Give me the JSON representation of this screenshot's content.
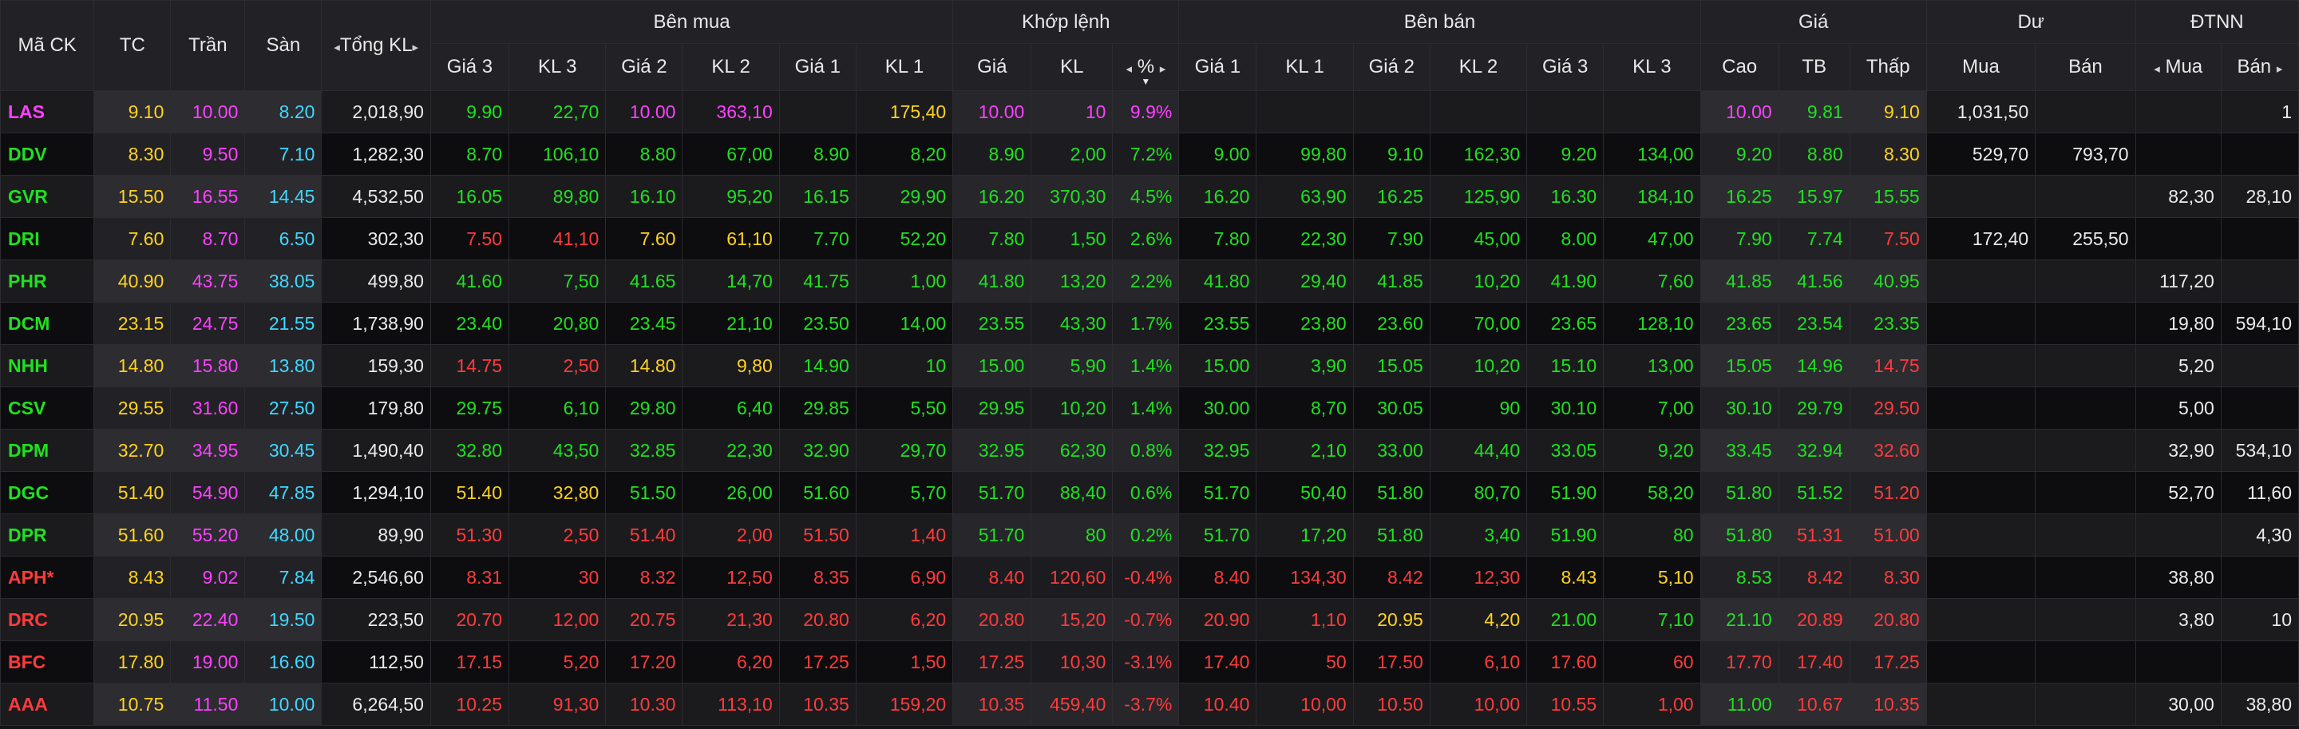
{
  "headers": {
    "symbol": "Mã CK",
    "ref": "TC",
    "ceil": "Trần",
    "floor": "Sàn",
    "total_vol": "Tổng KL",
    "buy_side": "Bên mua",
    "matched": "Khớp lệnh",
    "sell_side": "Bên bán",
    "price": "Giá",
    "residual": "Dư",
    "foreign": "ĐTNN",
    "buy_sub": [
      "Giá 3",
      "KL 3",
      "Giá 2",
      "KL 2",
      "Giá 1",
      "KL 1"
    ],
    "match_sub": [
      "Giá",
      "KL",
      "%"
    ],
    "sell_sub": [
      "Giá 1",
      "KL 1",
      "Giá 2",
      "KL 2",
      "Giá 3",
      "KL 3"
    ],
    "price_sub": [
      "Cao",
      "TB",
      "Thấp"
    ],
    "residual_sub": [
      "Mua",
      "Bán"
    ],
    "foreign_sub": [
      "Mua",
      "Bán"
    ]
  },
  "icons": {
    "arrow_left": "◂",
    "arrow_right": "▸",
    "sort_desc": "▼"
  },
  "colors": {
    "up": "#1fe11f",
    "down": "#ff3b3b",
    "reference": "#ffd21f",
    "ceiling": "#ff40ff",
    "floor": "#40d8ff"
  },
  "rows": [
    {
      "sym": [
        "LAS",
        "ceil"
      ],
      "tc": "9.10",
      "tran": "10.00",
      "san": "8.20",
      "total": "2,018,90",
      "b3": [
        "9.90",
        "up"
      ],
      "bk3": [
        "22,70",
        "up"
      ],
      "b2": [
        "10.00",
        "ceil"
      ],
      "bk2": [
        "363,10",
        "ceil"
      ],
      "b1": [
        "",
        ""
      ],
      "bk1": [
        "175,40",
        "ref"
      ],
      "mp": [
        "10.00",
        "ceil"
      ],
      "mk": [
        "10",
        "ceil"
      ],
      "pct": [
        "9.9%",
        "ceil"
      ],
      "s1": [
        "",
        ""
      ],
      "sk1": [
        "",
        ""
      ],
      "s2": [
        "",
        ""
      ],
      "sk2": [
        "",
        ""
      ],
      "s3": [
        "",
        ""
      ],
      "sk3": [
        "",
        ""
      ],
      "cao": [
        "10.00",
        "ceil"
      ],
      "tb": [
        "9.81",
        "up"
      ],
      "thap": [
        "9.10",
        "ref"
      ],
      "dm": "1,031,50",
      "db": "",
      "fm": "",
      "fb": "1"
    },
    {
      "sym": [
        "DDV",
        "up"
      ],
      "tc": "8.30",
      "tran": "9.50",
      "san": "7.10",
      "total": "1,282,30",
      "b3": [
        "8.70",
        "up"
      ],
      "bk3": [
        "106,10",
        "up"
      ],
      "b2": [
        "8.80",
        "up"
      ],
      "bk2": [
        "67,00",
        "up"
      ],
      "b1": [
        "8.90",
        "up"
      ],
      "bk1": [
        "8,20",
        "up"
      ],
      "mp": [
        "8.90",
        "up"
      ],
      "mk": [
        "2,00",
        "up"
      ],
      "pct": [
        "7.2%",
        "up"
      ],
      "s1": [
        "9.00",
        "up"
      ],
      "sk1": [
        "99,80",
        "up"
      ],
      "s2": [
        "9.10",
        "up"
      ],
      "sk2": [
        "162,30",
        "up"
      ],
      "s3": [
        "9.20",
        "up"
      ],
      "sk3": [
        "134,00",
        "up"
      ],
      "cao": [
        "9.20",
        "up"
      ],
      "tb": [
        "8.80",
        "up"
      ],
      "thap": [
        "8.30",
        "ref"
      ],
      "dm": "529,70",
      "db": "793,70",
      "fm": "",
      "fb": ""
    },
    {
      "sym": [
        "GVR",
        "up"
      ],
      "tc": "15.50",
      "tran": "16.55",
      "san": "14.45",
      "total": "4,532,50",
      "b3": [
        "16.05",
        "up"
      ],
      "bk3": [
        "89,80",
        "up"
      ],
      "b2": [
        "16.10",
        "up"
      ],
      "bk2": [
        "95,20",
        "up"
      ],
      "b1": [
        "16.15",
        "up"
      ],
      "bk1": [
        "29,90",
        "up"
      ],
      "mp": [
        "16.20",
        "up"
      ],
      "mk": [
        "370,30",
        "up"
      ],
      "pct": [
        "4.5%",
        "up"
      ],
      "s1": [
        "16.20",
        "up"
      ],
      "sk1": [
        "63,90",
        "up"
      ],
      "s2": [
        "16.25",
        "up"
      ],
      "sk2": [
        "125,90",
        "up"
      ],
      "s3": [
        "16.30",
        "up"
      ],
      "sk3": [
        "184,10",
        "up"
      ],
      "cao": [
        "16.25",
        "up"
      ],
      "tb": [
        "15.97",
        "up"
      ],
      "thap": [
        "15.55",
        "up"
      ],
      "dm": "",
      "db": "",
      "fm": "82,30",
      "fb": "28,10"
    },
    {
      "sym": [
        "DRI",
        "up"
      ],
      "tc": "7.60",
      "tran": "8.70",
      "san": "6.50",
      "total": "302,30",
      "b3": [
        "7.50",
        "dn"
      ],
      "bk3": [
        "41,10",
        "dn"
      ],
      "b2": [
        "7.60",
        "ref"
      ],
      "bk2": [
        "61,10",
        "ref"
      ],
      "b1": [
        "7.70",
        "up"
      ],
      "bk1": [
        "52,20",
        "up"
      ],
      "mp": [
        "7.80",
        "up"
      ],
      "mk": [
        "1,50",
        "up"
      ],
      "pct": [
        "2.6%",
        "up"
      ],
      "s1": [
        "7.80",
        "up"
      ],
      "sk1": [
        "22,30",
        "up"
      ],
      "s2": [
        "7.90",
        "up"
      ],
      "sk2": [
        "45,00",
        "up"
      ],
      "s3": [
        "8.00",
        "up"
      ],
      "sk3": [
        "47,00",
        "up"
      ],
      "cao": [
        "7.90",
        "up"
      ],
      "tb": [
        "7.74",
        "up"
      ],
      "thap": [
        "7.50",
        "dn"
      ],
      "dm": "172,40",
      "db": "255,50",
      "fm": "",
      "fb": ""
    },
    {
      "sym": [
        "PHR",
        "up"
      ],
      "tc": "40.90",
      "tran": "43.75",
      "san": "38.05",
      "total": "499,80",
      "b3": [
        "41.60",
        "up"
      ],
      "bk3": [
        "7,50",
        "up"
      ],
      "b2": [
        "41.65",
        "up"
      ],
      "bk2": [
        "14,70",
        "up"
      ],
      "b1": [
        "41.75",
        "up"
      ],
      "bk1": [
        "1,00",
        "up"
      ],
      "mp": [
        "41.80",
        "up"
      ],
      "mk": [
        "13,20",
        "up"
      ],
      "pct": [
        "2.2%",
        "up"
      ],
      "s1": [
        "41.80",
        "up"
      ],
      "sk1": [
        "29,40",
        "up"
      ],
      "s2": [
        "41.85",
        "up"
      ],
      "sk2": [
        "10,20",
        "up"
      ],
      "s3": [
        "41.90",
        "up"
      ],
      "sk3": [
        "7,60",
        "up"
      ],
      "cao": [
        "41.85",
        "up"
      ],
      "tb": [
        "41.56",
        "up"
      ],
      "thap": [
        "40.95",
        "up"
      ],
      "dm": "",
      "db": "",
      "fm": "117,20",
      "fb": ""
    },
    {
      "sym": [
        "DCM",
        "up"
      ],
      "tc": "23.15",
      "tran": "24.75",
      "san": "21.55",
      "total": "1,738,90",
      "b3": [
        "23.40",
        "up"
      ],
      "bk3": [
        "20,80",
        "up"
      ],
      "b2": [
        "23.45",
        "up"
      ],
      "bk2": [
        "21,10",
        "up"
      ],
      "b1": [
        "23.50",
        "up"
      ],
      "bk1": [
        "14,00",
        "up"
      ],
      "mp": [
        "23.55",
        "up"
      ],
      "mk": [
        "43,30",
        "up"
      ],
      "pct": [
        "1.7%",
        "up"
      ],
      "s1": [
        "23.55",
        "up"
      ],
      "sk1": [
        "23,80",
        "up"
      ],
      "s2": [
        "23.60",
        "up"
      ],
      "sk2": [
        "70,00",
        "up"
      ],
      "s3": [
        "23.65",
        "up"
      ],
      "sk3": [
        "128,10",
        "up"
      ],
      "cao": [
        "23.65",
        "up"
      ],
      "tb": [
        "23.54",
        "up"
      ],
      "thap": [
        "23.35",
        "up"
      ],
      "dm": "",
      "db": "",
      "fm": "19,80",
      "fb": "594,10"
    },
    {
      "sym": [
        "NHH",
        "up"
      ],
      "tc": "14.80",
      "tran": "15.80",
      "san": "13.80",
      "total": "159,30",
      "b3": [
        "14.75",
        "dn"
      ],
      "bk3": [
        "2,50",
        "dn"
      ],
      "b2": [
        "14.80",
        "ref"
      ],
      "bk2": [
        "9,80",
        "ref"
      ],
      "b1": [
        "14.90",
        "up"
      ],
      "bk1": [
        "10",
        "up"
      ],
      "mp": [
        "15.00",
        "up"
      ],
      "mk": [
        "5,90",
        "up"
      ],
      "pct": [
        "1.4%",
        "up"
      ],
      "s1": [
        "15.00",
        "up"
      ],
      "sk1": [
        "3,90",
        "up"
      ],
      "s2": [
        "15.05",
        "up"
      ],
      "sk2": [
        "10,20",
        "up"
      ],
      "s3": [
        "15.10",
        "up"
      ],
      "sk3": [
        "13,00",
        "up"
      ],
      "cao": [
        "15.05",
        "up"
      ],
      "tb": [
        "14.96",
        "up"
      ],
      "thap": [
        "14.75",
        "dn"
      ],
      "dm": "",
      "db": "",
      "fm": "5,20",
      "fb": ""
    },
    {
      "sym": [
        "CSV",
        "up"
      ],
      "tc": "29.55",
      "tran": "31.60",
      "san": "27.50",
      "total": "179,80",
      "b3": [
        "29.75",
        "up"
      ],
      "bk3": [
        "6,10",
        "up"
      ],
      "b2": [
        "29.80",
        "up"
      ],
      "bk2": [
        "6,40",
        "up"
      ],
      "b1": [
        "29.85",
        "up"
      ],
      "bk1": [
        "5,50",
        "up"
      ],
      "mp": [
        "29.95",
        "up"
      ],
      "mk": [
        "10,20",
        "up"
      ],
      "pct": [
        "1.4%",
        "up"
      ],
      "s1": [
        "30.00",
        "up"
      ],
      "sk1": [
        "8,70",
        "up"
      ],
      "s2": [
        "30.05",
        "up"
      ],
      "sk2": [
        "90",
        "up"
      ],
      "s3": [
        "30.10",
        "up"
      ],
      "sk3": [
        "7,00",
        "up"
      ],
      "cao": [
        "30.10",
        "up"
      ],
      "tb": [
        "29.79",
        "up"
      ],
      "thap": [
        "29.50",
        "dn"
      ],
      "dm": "",
      "db": "",
      "fm": "5,00",
      "fb": ""
    },
    {
      "sym": [
        "DPM",
        "up"
      ],
      "tc": "32.70",
      "tran": "34.95",
      "san": "30.45",
      "total": "1,490,40",
      "b3": [
        "32.80",
        "up"
      ],
      "bk3": [
        "43,50",
        "up"
      ],
      "b2": [
        "32.85",
        "up"
      ],
      "bk2": [
        "22,30",
        "up"
      ],
      "b1": [
        "32.90",
        "up"
      ],
      "bk1": [
        "29,70",
        "up"
      ],
      "mp": [
        "32.95",
        "up"
      ],
      "mk": [
        "62,30",
        "up"
      ],
      "pct": [
        "0.8%",
        "up"
      ],
      "s1": [
        "32.95",
        "up"
      ],
      "sk1": [
        "2,10",
        "up"
      ],
      "s2": [
        "33.00",
        "up"
      ],
      "sk2": [
        "44,40",
        "up"
      ],
      "s3": [
        "33.05",
        "up"
      ],
      "sk3": [
        "9,20",
        "up"
      ],
      "cao": [
        "33.45",
        "up"
      ],
      "tb": [
        "32.94",
        "up"
      ],
      "thap": [
        "32.60",
        "dn"
      ],
      "dm": "",
      "db": "",
      "fm": "32,90",
      "fb": "534,10"
    },
    {
      "sym": [
        "DGC",
        "up"
      ],
      "tc": "51.40",
      "tran": "54.90",
      "san": "47.85",
      "total": "1,294,10",
      "b3": [
        "51.40",
        "ref"
      ],
      "bk3": [
        "32,80",
        "ref"
      ],
      "b2": [
        "51.50",
        "up"
      ],
      "bk2": [
        "26,00",
        "up"
      ],
      "b1": [
        "51.60",
        "up"
      ],
      "bk1": [
        "5,70",
        "up"
      ],
      "mp": [
        "51.70",
        "up"
      ],
      "mk": [
        "88,40",
        "up"
      ],
      "pct": [
        "0.6%",
        "up"
      ],
      "s1": [
        "51.70",
        "up"
      ],
      "sk1": [
        "50,40",
        "up"
      ],
      "s2": [
        "51.80",
        "up"
      ],
      "sk2": [
        "80,70",
        "up"
      ],
      "s3": [
        "51.90",
        "up"
      ],
      "sk3": [
        "58,20",
        "up"
      ],
      "cao": [
        "51.80",
        "up"
      ],
      "tb": [
        "51.52",
        "up"
      ],
      "thap": [
        "51.20",
        "dn"
      ],
      "dm": "",
      "db": "",
      "fm": "52,70",
      "fb": "11,60"
    },
    {
      "sym": [
        "DPR",
        "up"
      ],
      "tc": "51.60",
      "tran": "55.20",
      "san": "48.00",
      "total": "89,90",
      "b3": [
        "51.30",
        "dn"
      ],
      "bk3": [
        "2,50",
        "dn"
      ],
      "b2": [
        "51.40",
        "dn"
      ],
      "bk2": [
        "2,00",
        "dn"
      ],
      "b1": [
        "51.50",
        "dn"
      ],
      "bk1": [
        "1,40",
        "dn"
      ],
      "mp": [
        "51.70",
        "up"
      ],
      "mk": [
        "80",
        "up"
      ],
      "pct": [
        "0.2%",
        "up"
      ],
      "s1": [
        "51.70",
        "up"
      ],
      "sk1": [
        "17,20",
        "up"
      ],
      "s2": [
        "51.80",
        "up"
      ],
      "sk2": [
        "3,40",
        "up"
      ],
      "s3": [
        "51.90",
        "up"
      ],
      "sk3": [
        "80",
        "up"
      ],
      "cao": [
        "51.80",
        "up"
      ],
      "tb": [
        "51.31",
        "dn"
      ],
      "thap": [
        "51.00",
        "dn"
      ],
      "dm": "",
      "db": "",
      "fm": "",
      "fb": "4,30"
    },
    {
      "sym": [
        "APH*",
        "dn"
      ],
      "tc": "8.43",
      "tran": "9.02",
      "san": "7.84",
      "total": "2,546,60",
      "b3": [
        "8.31",
        "dn"
      ],
      "bk3": [
        "30",
        "dn"
      ],
      "b2": [
        "8.32",
        "dn"
      ],
      "bk2": [
        "12,50",
        "dn"
      ],
      "b1": [
        "8.35",
        "dn"
      ],
      "bk1": [
        "6,90",
        "dn"
      ],
      "mp": [
        "8.40",
        "dn"
      ],
      "mk": [
        "120,60",
        "dn"
      ],
      "pct": [
        "-0.4%",
        "dn"
      ],
      "s1": [
        "8.40",
        "dn"
      ],
      "sk1": [
        "134,30",
        "dn"
      ],
      "s2": [
        "8.42",
        "dn"
      ],
      "sk2": [
        "12,30",
        "dn"
      ],
      "s3": [
        "8.43",
        "ref"
      ],
      "sk3": [
        "5,10",
        "ref"
      ],
      "cao": [
        "8.53",
        "up"
      ],
      "tb": [
        "8.42",
        "dn"
      ],
      "thap": [
        "8.30",
        "dn"
      ],
      "dm": "",
      "db": "",
      "fm": "38,80",
      "fb": ""
    },
    {
      "sym": [
        "DRC",
        "dn"
      ],
      "tc": "20.95",
      "tran": "22.40",
      "san": "19.50",
      "total": "223,50",
      "b3": [
        "20.70",
        "dn"
      ],
      "bk3": [
        "12,00",
        "dn"
      ],
      "b2": [
        "20.75",
        "dn"
      ],
      "bk2": [
        "21,30",
        "dn"
      ],
      "b1": [
        "20.80",
        "dn"
      ],
      "bk1": [
        "6,20",
        "dn"
      ],
      "mp": [
        "20.80",
        "dn"
      ],
      "mk": [
        "15,20",
        "dn"
      ],
      "pct": [
        "-0.7%",
        "dn"
      ],
      "s1": [
        "20.90",
        "dn"
      ],
      "sk1": [
        "1,10",
        "dn"
      ],
      "s2": [
        "20.95",
        "ref"
      ],
      "sk2": [
        "4,20",
        "ref"
      ],
      "s3": [
        "21.00",
        "up"
      ],
      "sk3": [
        "7,10",
        "up"
      ],
      "cao": [
        "21.10",
        "up"
      ],
      "tb": [
        "20.89",
        "dn"
      ],
      "thap": [
        "20.80",
        "dn"
      ],
      "dm": "",
      "db": "",
      "fm": "3,80",
      "fb": "10"
    },
    {
      "sym": [
        "BFC",
        "dn"
      ],
      "tc": "17.80",
      "tran": "19.00",
      "san": "16.60",
      "total": "112,50",
      "b3": [
        "17.15",
        "dn"
      ],
      "bk3": [
        "5,20",
        "dn"
      ],
      "b2": [
        "17.20",
        "dn"
      ],
      "bk2": [
        "6,20",
        "dn"
      ],
      "b1": [
        "17.25",
        "dn"
      ],
      "bk1": [
        "1,50",
        "dn"
      ],
      "mp": [
        "17.25",
        "dn"
      ],
      "mk": [
        "10,30",
        "dn"
      ],
      "pct": [
        "-3.1%",
        "dn"
      ],
      "s1": [
        "17.40",
        "dn"
      ],
      "sk1": [
        "50",
        "dn"
      ],
      "s2": [
        "17.50",
        "dn"
      ],
      "sk2": [
        "6,10",
        "dn"
      ],
      "s3": [
        "17.60",
        "dn"
      ],
      "sk3": [
        "60",
        "dn"
      ],
      "cao": [
        "17.70",
        "dn"
      ],
      "tb": [
        "17.40",
        "dn"
      ],
      "thap": [
        "17.25",
        "dn"
      ],
      "dm": "",
      "db": "",
      "fm": "",
      "fb": ""
    },
    {
      "sym": [
        "AAA",
        "dn"
      ],
      "tc": "10.75",
      "tran": "11.50",
      "san": "10.00",
      "total": "6,264,50",
      "b3": [
        "10.25",
        "dn"
      ],
      "bk3": [
        "91,30",
        "dn"
      ],
      "b2": [
        "10.30",
        "dn"
      ],
      "bk2": [
        "113,10",
        "dn"
      ],
      "b1": [
        "10.35",
        "dn"
      ],
      "bk1": [
        "159,20",
        "dn"
      ],
      "mp": [
        "10.35",
        "dn"
      ],
      "mk": [
        "459,40",
        "dn"
      ],
      "pct": [
        "-3.7%",
        "dn"
      ],
      "s1": [
        "10.40",
        "dn"
      ],
      "sk1": [
        "10,00",
        "dn"
      ],
      "s2": [
        "10.50",
        "dn"
      ],
      "sk2": [
        "10,00",
        "dn"
      ],
      "s3": [
        "10.55",
        "dn"
      ],
      "sk3": [
        "1,00",
        "dn"
      ],
      "cao": [
        "11.00",
        "up"
      ],
      "tb": [
        "10.67",
        "dn"
      ],
      "thap": [
        "10.35",
        "dn"
      ],
      "dm": "",
      "db": "",
      "fm": "30,00",
      "fb": "38,80"
    }
  ]
}
